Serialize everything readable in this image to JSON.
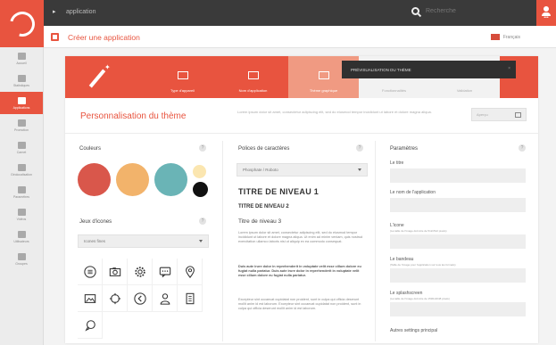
{
  "topbar": {
    "crumb": "application",
    "search_placeholder": "Recherche"
  },
  "subbar": {
    "title": "Créer une application",
    "language": "Français"
  },
  "rail": {
    "items": [
      {
        "label": "Accueil",
        "icon": "home-icon"
      },
      {
        "label": "Statistiques",
        "icon": "chart-icon"
      },
      {
        "label": "Applications",
        "icon": "app-icon",
        "active": true
      },
      {
        "label": "Promotion",
        "icon": "megaphone-icon"
      },
      {
        "label": "Carnet",
        "icon": "book-icon"
      },
      {
        "label": "Géolocalisation",
        "icon": "pin-icon"
      },
      {
        "label": "Paramètres",
        "icon": "gear-icon"
      },
      {
        "label": "Vidéos",
        "icon": "video-icon"
      },
      {
        "label": "Utilisateurs",
        "icon": "user-icon"
      },
      {
        "label": "Groupes",
        "icon": "group-icon"
      }
    ]
  },
  "wizard": {
    "steps": [
      {
        "label": "Type d'appareil"
      },
      {
        "label": "Nom d'application"
      },
      {
        "label": "Thème graphique",
        "active": true
      },
      {
        "label": "Fonctionnalités"
      },
      {
        "label": "Validation"
      }
    ],
    "tooltip": "PRÉVISUALISATION DU THÈME"
  },
  "section": {
    "title": "Personnalisation du thème",
    "description": "Lorem ipsum dolor sit amet, consectetur adipiscing elit, sed do eiusmod tempor incididunt ut labore et dolore magna aliqua.",
    "preview_label": "Aperçu"
  },
  "colors": {
    "title": "Couleurs",
    "swatches": [
      "#d9574b",
      "#f2b36b",
      "#6ab4b6",
      "#fbe6b0",
      "#111111"
    ]
  },
  "icon_sets": {
    "title": "Jeux d'icones",
    "selected": "Icones fines",
    "icons": [
      "list-icon",
      "camera-icon",
      "gear-icon",
      "chat-icon",
      "location-pin-icon",
      "image-icon",
      "crosshair-icon",
      "back-arrow-icon",
      "user-icon",
      "document-icon",
      "chat-bubble-icon"
    ]
  },
  "fonts": {
    "title": "Polices de caractères",
    "selected": "Phosphate / Roboto",
    "h1": "TITRE DE NIVEAU 1",
    "h2": "TITRE DE NIVEAU 2",
    "h3": "Titre de niveau 3",
    "p1": "Lorem ipsum dolor sit amet, consectetur adipiscing elit, sed do eiusmod tempor incididunt ut labore et dolore magna aliqua. Ut enim ad minim veniam, quis nostrud exercitation ullamco laboris nisi ut aliquip ex ea commodo consequat.",
    "p2": "Duis aute irure dolor in reprehenderit in voluptate velit esse cillum dolore eu fugiat nulla pariatur. Duis aute irure dolor in reprehenderit in voluptate velit esse cillum dolore eu fugiat nulla pariatur.",
    "p3": "Excepteur sint occaecat cupidatat non proident, sunt in culpa qui officia deserunt mollit anim id est laborum. Excepteur sint occaecat cupidatat non proident, sunt in culpa qui officia deserunt mollit anim id est laborum."
  },
  "params": {
    "title": "Paramètres",
    "fields": [
      {
        "label": "Le titre",
        "hint": ""
      },
      {
        "label": "Le nom de l'application",
        "hint": ""
      },
      {
        "label": "L'icone",
        "hint": "(La taille de l'image doit être de 512x512 pixels)"
      },
      {
        "label": "Le bandeau",
        "hint": "(Taille de l'image pour l'application sur tous les formats)"
      },
      {
        "label": "Le splashscreen",
        "hint": "(La taille de l'image doit être de 1536x2048 pixels)"
      }
    ],
    "more": "Autres settings principal"
  }
}
